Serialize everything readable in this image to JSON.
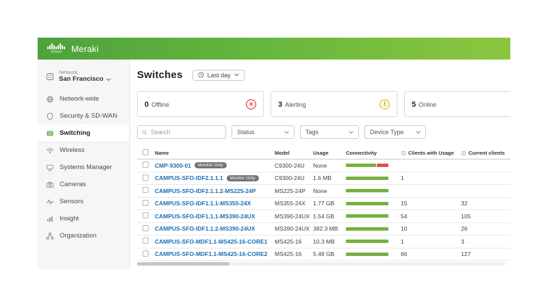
{
  "brand": {
    "cisco_label": "cisco",
    "product_label": "Meraki"
  },
  "sidebar": {
    "network_label": "Network",
    "network_name": "San Francisco",
    "items": [
      {
        "label": "Network-wide",
        "icon": "network-wide-icon",
        "active": false
      },
      {
        "label": "Security & SD-WAN",
        "icon": "shield-icon",
        "active": false
      },
      {
        "label": "Switching",
        "icon": "switch-icon",
        "active": true
      },
      {
        "label": "Wireless",
        "icon": "wifi-icon",
        "active": false
      },
      {
        "label": "Systems Manager",
        "icon": "devices-icon",
        "active": false
      },
      {
        "label": "Cameras",
        "icon": "camera-icon",
        "active": false
      },
      {
        "label": "Sensors",
        "icon": "sensor-icon",
        "active": false
      },
      {
        "label": "Insight",
        "icon": "bar-chart-icon",
        "active": false
      },
      {
        "label": "Organization",
        "icon": "organization-icon",
        "active": false
      }
    ]
  },
  "page": {
    "title": "Switches",
    "time_range_label": "Last day"
  },
  "status_cards": [
    {
      "count": "0",
      "label": "Offline",
      "icon": "offline-icon",
      "color": "#e0282e"
    },
    {
      "count": "3",
      "label": "Alerting",
      "icon": "alerting-icon",
      "color": "#e3b428"
    },
    {
      "count": "5",
      "label": "Online",
      "icon": "online-icon",
      "color": "#61b346"
    }
  ],
  "filters": {
    "search_placeholder": "Search",
    "status_label": "Status",
    "tags_label": "Tags",
    "device_type_label": "Device Type"
  },
  "table": {
    "columns": {
      "name": "Name",
      "model": "Model",
      "usage": "Usage",
      "connectivity": "Connectivity",
      "clients_with_usage": "Clients with Usage",
      "current_clients": "Current clients"
    },
    "colors": {
      "connectivity_green": "#76b041",
      "connectivity_red": "#d9534f",
      "link_blue": "#1a6fb5"
    },
    "rows": [
      {
        "name": "CMP-9300-01",
        "badge": "Monitor Only",
        "model": "C9300-24U",
        "usage": "None",
        "connectivity": [
          {
            "color": "#76b041",
            "pct": 72
          },
          {
            "color": "#d9534f",
            "pct": 28
          }
        ],
        "clients_with_usage": "",
        "current_clients": ""
      },
      {
        "name": "CAMPUS-SFO-IDF2.1.1.1",
        "badge": "Monitor Only",
        "model": "C9300-24U",
        "usage": "1.6 MB",
        "connectivity": [
          {
            "color": "#76b041",
            "pct": 100
          }
        ],
        "clients_with_usage": "1",
        "current_clients": ""
      },
      {
        "name": "CAMPUS-SFO-IDF2.1.1.2-MS225-24P",
        "badge": "",
        "model": "MS225-24P",
        "usage": "None",
        "connectivity": [
          {
            "color": "#76b041",
            "pct": 100
          }
        ],
        "clients_with_usage": "",
        "current_clients": ""
      },
      {
        "name": "CAMPUS-SFO-IDF1.1.1-MS355-24X",
        "badge": "",
        "model": "MS355-24X",
        "usage": "1.77 GB",
        "connectivity": [
          {
            "color": "#76b041",
            "pct": 100
          }
        ],
        "clients_with_usage": "15",
        "current_clients": "32"
      },
      {
        "name": "CAMPUS-SFO-IDF1.1.1-MS390-24UX",
        "badge": "",
        "model": "MS390-24UX",
        "usage": "1.54 GB",
        "connectivity": [
          {
            "color": "#76b041",
            "pct": 100
          }
        ],
        "clients_with_usage": "54",
        "current_clients": "105"
      },
      {
        "name": "CAMPUS-SFO-IDF1.1.2-MS390-24UX",
        "badge": "",
        "model": "MS390-24UX",
        "usage": "382.3 MB",
        "connectivity": [
          {
            "color": "#76b041",
            "pct": 100
          }
        ],
        "clients_with_usage": "10",
        "current_clients": "26"
      },
      {
        "name": "CAMPUS-SFO-MDF1.1-MS425-16-CORE1",
        "badge": "",
        "model": "MS425-16",
        "usage": "10.3 MB",
        "connectivity": [
          {
            "color": "#76b041",
            "pct": 100
          }
        ],
        "clients_with_usage": "1",
        "current_clients": "3"
      },
      {
        "name": "CAMPUS-SFO-MDF1.1-MS425-16-CORE2",
        "badge": "",
        "model": "MS425-16",
        "usage": "5.48 GB",
        "connectivity": [
          {
            "color": "#76b041",
            "pct": 100
          }
        ],
        "clients_with_usage": "66",
        "current_clients": "127"
      }
    ]
  }
}
